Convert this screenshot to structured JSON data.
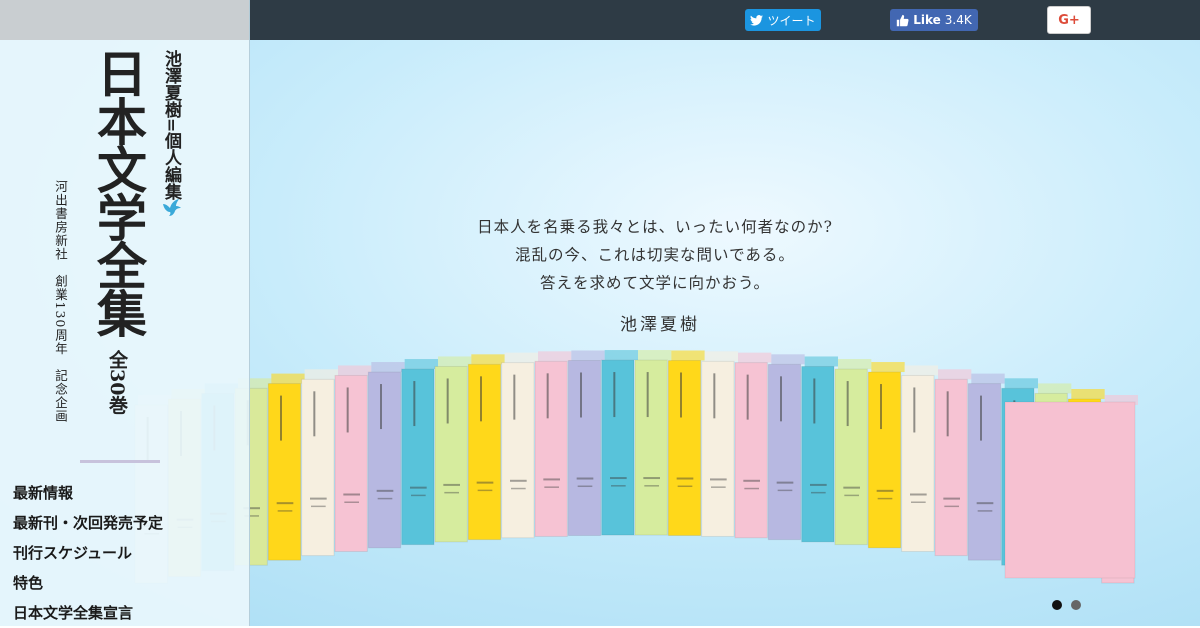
{
  "social": {
    "tweet_label": "ツイート",
    "like_label": "Like",
    "like_count": "3.4K",
    "gplus_label": "G+"
  },
  "brand": {
    "editor": "池澤夏樹=個人編集",
    "title": "日本文学全集",
    "total": "全30巻",
    "publisher": "河出書房新社　創業130周年　記念企画"
  },
  "nav": {
    "items": [
      "最新情報",
      "最新刊・次回発売予定",
      "刊行スケジュール",
      "特色",
      "日本文学全集宣言"
    ]
  },
  "hero": {
    "tagline": [
      "日本人を名乗る我々とは、いったい何者なのか?",
      "混乱の今、これは切実な問いである。",
      "答えを求めて文学に向かおう。"
    ],
    "author": "池澤夏樹",
    "book_colors": [
      "#f0f0f0",
      "#f7e9a0",
      "#5cc4dc",
      "#d9e99a",
      "#ffd71a",
      "#f6efe0",
      "#f6c3d3",
      "#b7b8e1",
      "#58c3da",
      "#d6ec9e",
      "#ffd81a",
      "#f6efe0",
      "#f6c3d3",
      "#b7b8e1",
      "#58c3da",
      "#d6ec9e",
      "#ffd81a",
      "#f6efe0",
      "#f6c3d3",
      "#b7b8e1",
      "#58c3da",
      "#d6ec9e",
      "#ffd81a",
      "#f6efe0",
      "#f6c3d3",
      "#b7b8e1",
      "#58c3da",
      "#d6ec9e",
      "#ffd81a",
      "#f6c3d3"
    ]
  },
  "carousel": {
    "slides": 2,
    "active": 1
  }
}
